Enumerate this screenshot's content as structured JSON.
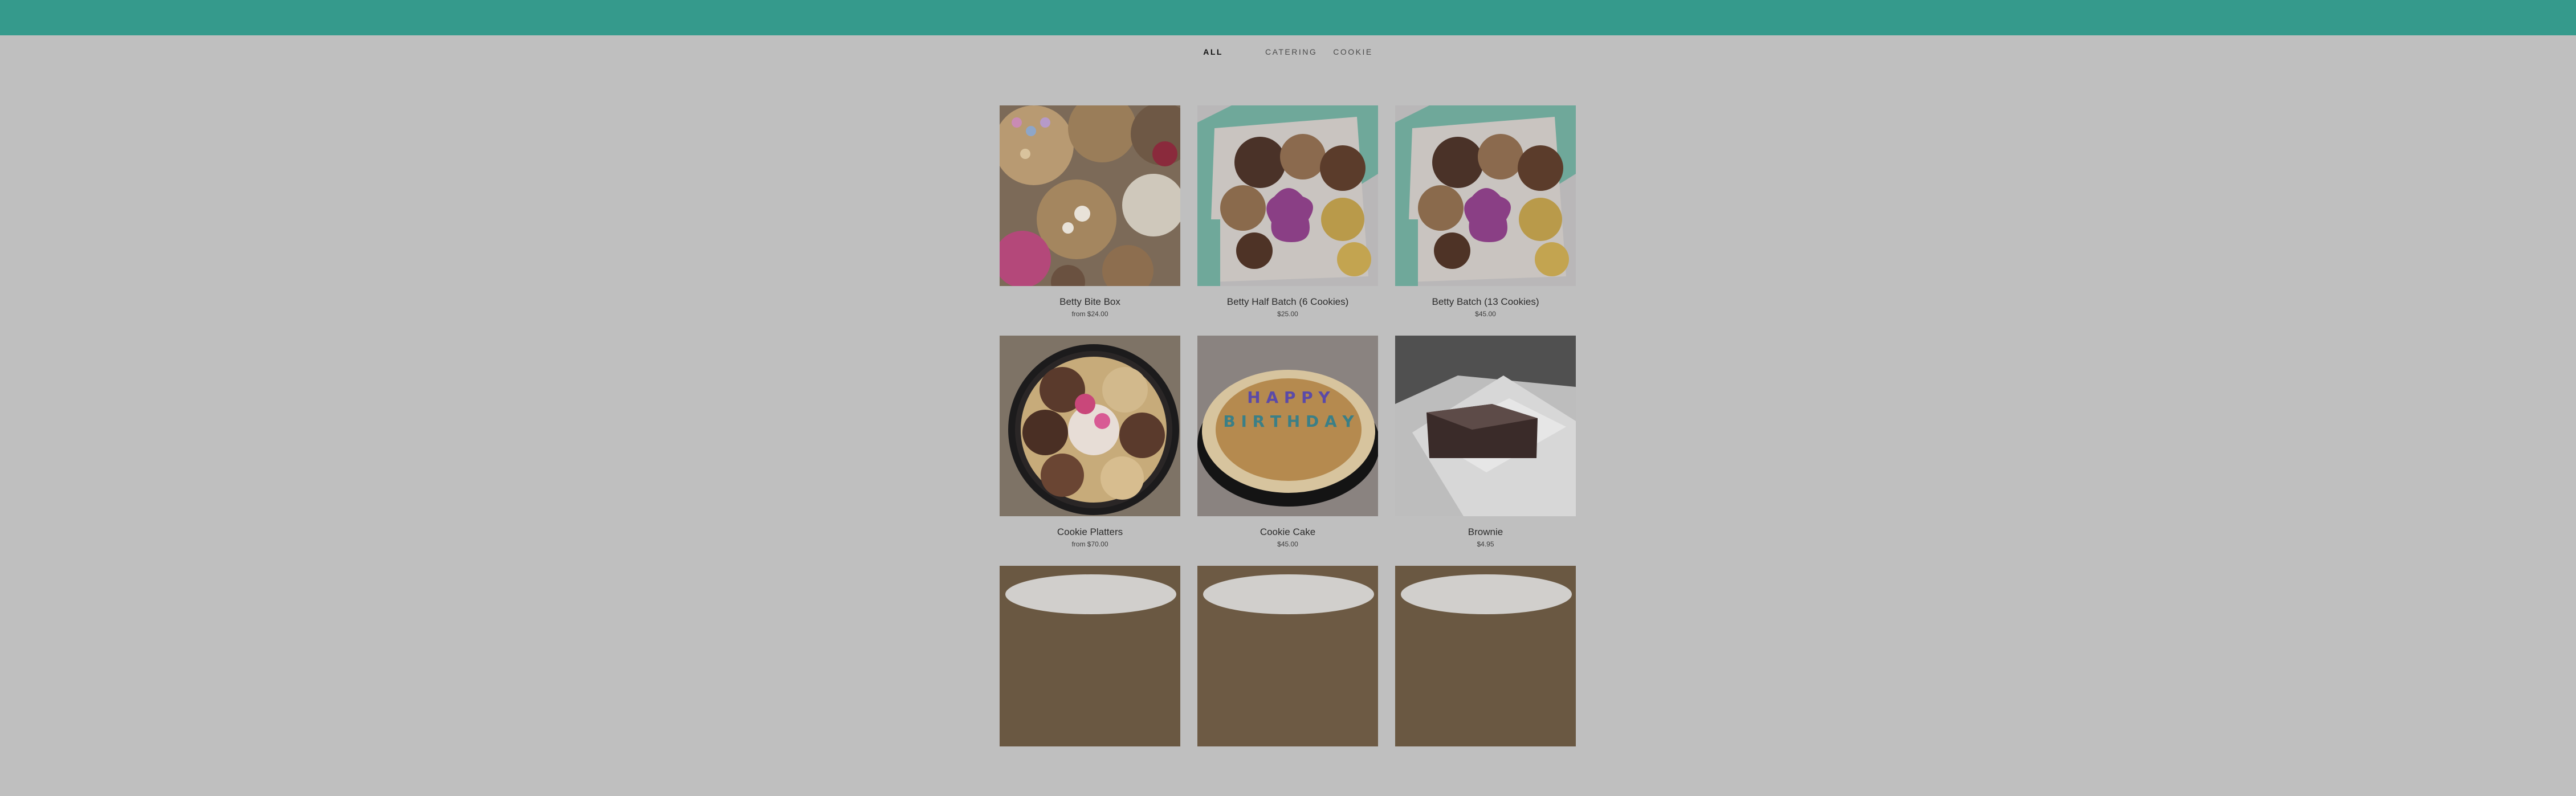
{
  "filters": [
    {
      "label": "ALL",
      "active": true
    },
    {
      "label": "CATERING",
      "active": false
    },
    {
      "label": "COOKIE",
      "active": false
    }
  ],
  "products": [
    {
      "name": "Betty Bite Box",
      "price": "from $24.00",
      "image": "cookie-assortment"
    },
    {
      "name": "Betty Half Batch (6 Cookies)",
      "price": "$25.00",
      "image": "cookie-box"
    },
    {
      "name": "Betty Batch (13 Cookies)",
      "price": "$45.00",
      "image": "cookie-box"
    },
    {
      "name": "Cookie Platters",
      "price": "from $70.00",
      "image": "cookie-platter"
    },
    {
      "name": "Cookie Cake",
      "price": "$45.00",
      "image": "cookie-cake"
    },
    {
      "name": "Brownie",
      "price": "$4.95",
      "image": "brownie"
    },
    {
      "name": "",
      "price": "",
      "image": "dish"
    },
    {
      "name": "",
      "price": "",
      "image": "dish"
    },
    {
      "name": "",
      "price": "",
      "image": "dish"
    }
  ],
  "cookie_cake_text": "HAPPY BIRTHDAY",
  "colors": {
    "header": "#359a8c",
    "overlay": "#bfbfbf"
  }
}
